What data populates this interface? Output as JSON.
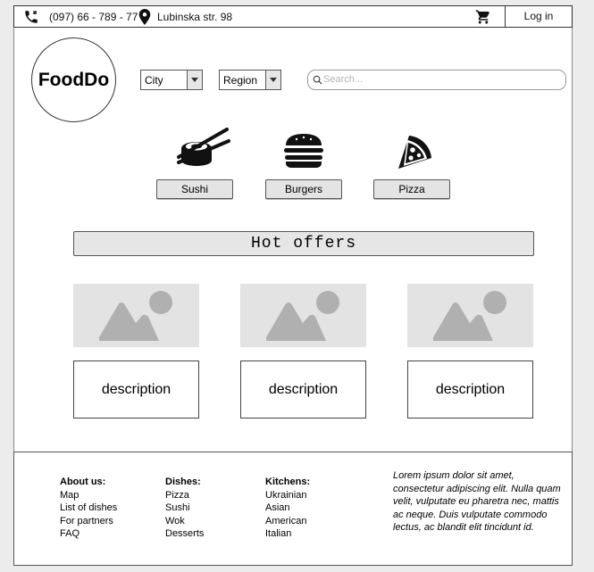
{
  "topbar": {
    "phone": "(097) 66 - 789 - 77",
    "address": "Lubinska str. 98",
    "login_label": "Log in"
  },
  "header": {
    "logo": "FoodDo",
    "city_select": "City",
    "region_select": "Region",
    "search_placeholder": "Search..."
  },
  "categories": [
    {
      "label": "Sushi",
      "icon": "sushi-icon"
    },
    {
      "label": "Burgers",
      "icon": "burger-icon"
    },
    {
      "label": "Pizza",
      "icon": "pizza-icon"
    }
  ],
  "hot_offers": {
    "title": "Hot offers",
    "cards": [
      {
        "description": "description"
      },
      {
        "description": "description"
      },
      {
        "description": "description"
      }
    ]
  },
  "footer": {
    "about": {
      "title": "About us:",
      "items": [
        "Map",
        "List of dishes",
        "For partners",
        "FAQ"
      ]
    },
    "dishes": {
      "title": "Dishes:",
      "items": [
        "Pizza",
        "Sushi",
        "Wok",
        "Desserts"
      ]
    },
    "kitchens": {
      "title": "Kitchens:",
      "items": [
        "Ukrainian",
        "Asian",
        "American",
        "Italian"
      ]
    },
    "lorem": "Lorem ipsum dolor sit amet, consectetur adipiscing elit. Nulla quam velit, vulputate eu pharetra nec, mattis ac neque. Duis vulputate commodo lectus, ac blandit elit tincidunt id."
  },
  "colors": {
    "background": "#ececec",
    "placeholder_fill": "#e3e3e3",
    "placeholder_shape": "#b0b0b0"
  }
}
